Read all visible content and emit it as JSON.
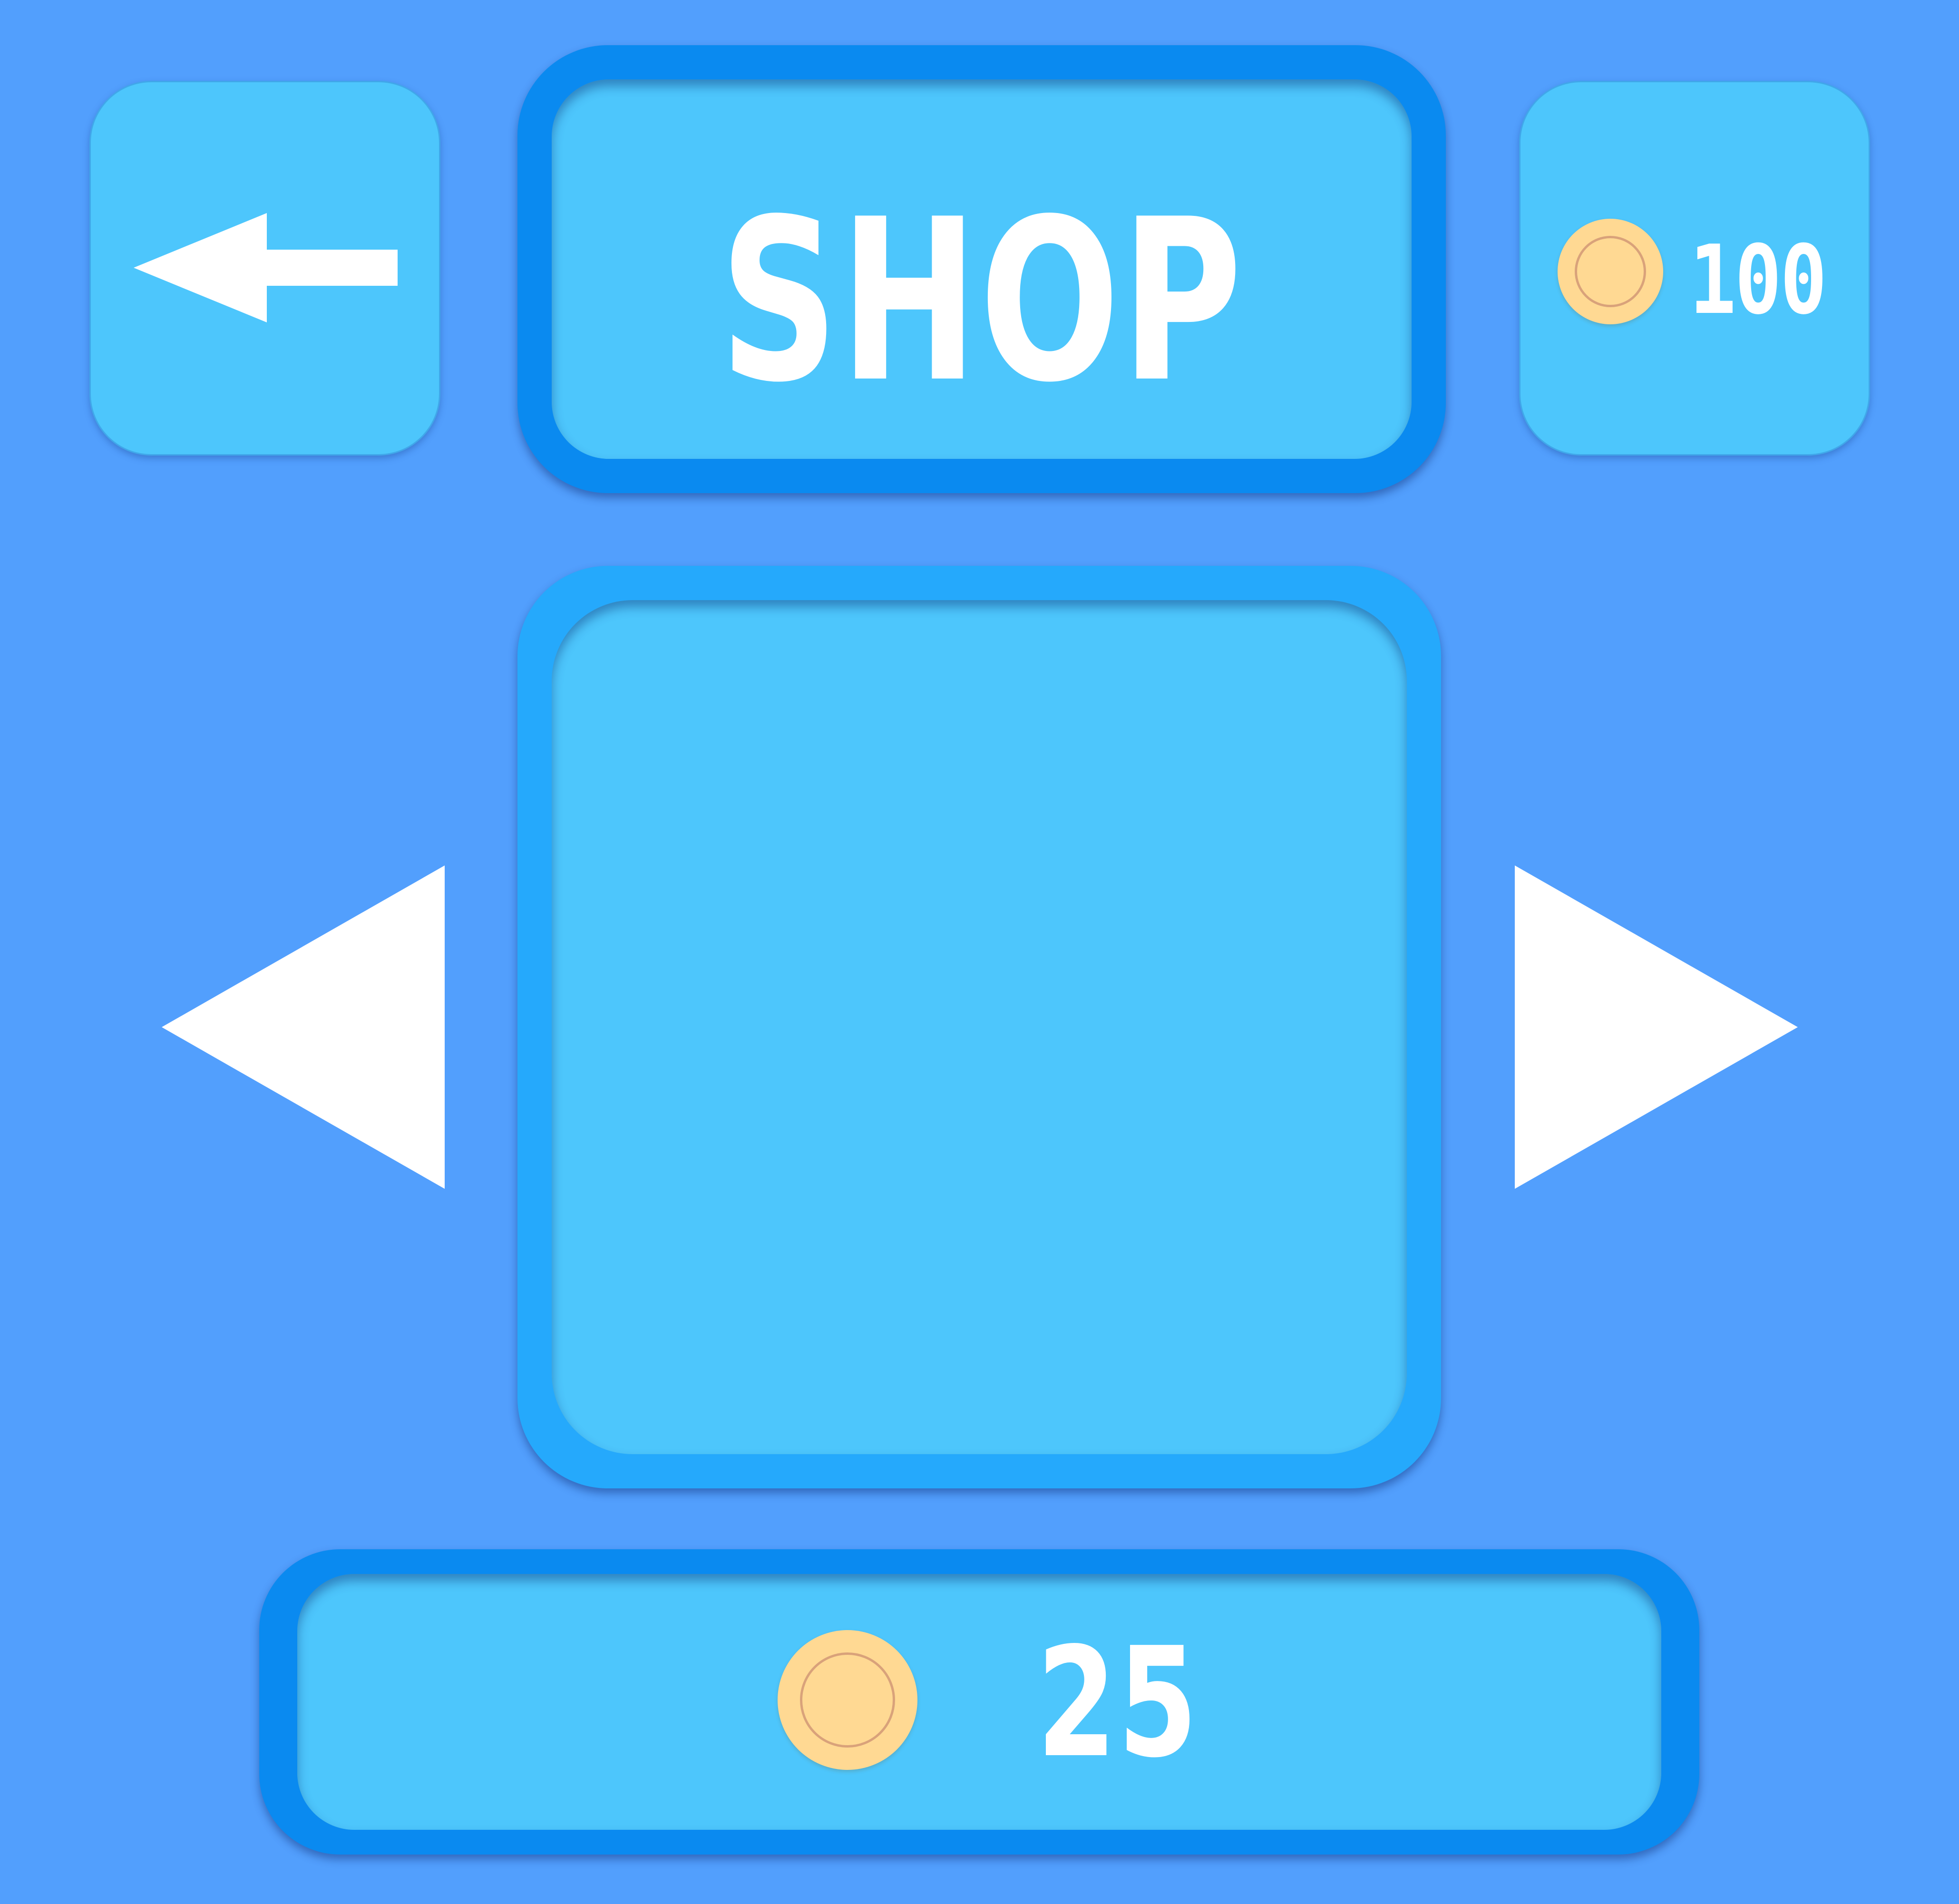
{
  "header": {
    "back_icon": "arrow-left-icon",
    "title": "SHOP",
    "coins": {
      "icon": "coin-icon",
      "value": "100"
    }
  },
  "preview": {
    "prev_icon": "triangle-left-icon",
    "next_icon": "triangle-right-icon"
  },
  "price": {
    "icon": "coin-icon",
    "value": "25"
  },
  "colors": {
    "background": "#529ffd",
    "panel": "#4dc6fc",
    "frame_dark": "#0a8af0",
    "frame_light": "#25a9fc",
    "coin": "#ffd993",
    "text": "#ffffff"
  }
}
